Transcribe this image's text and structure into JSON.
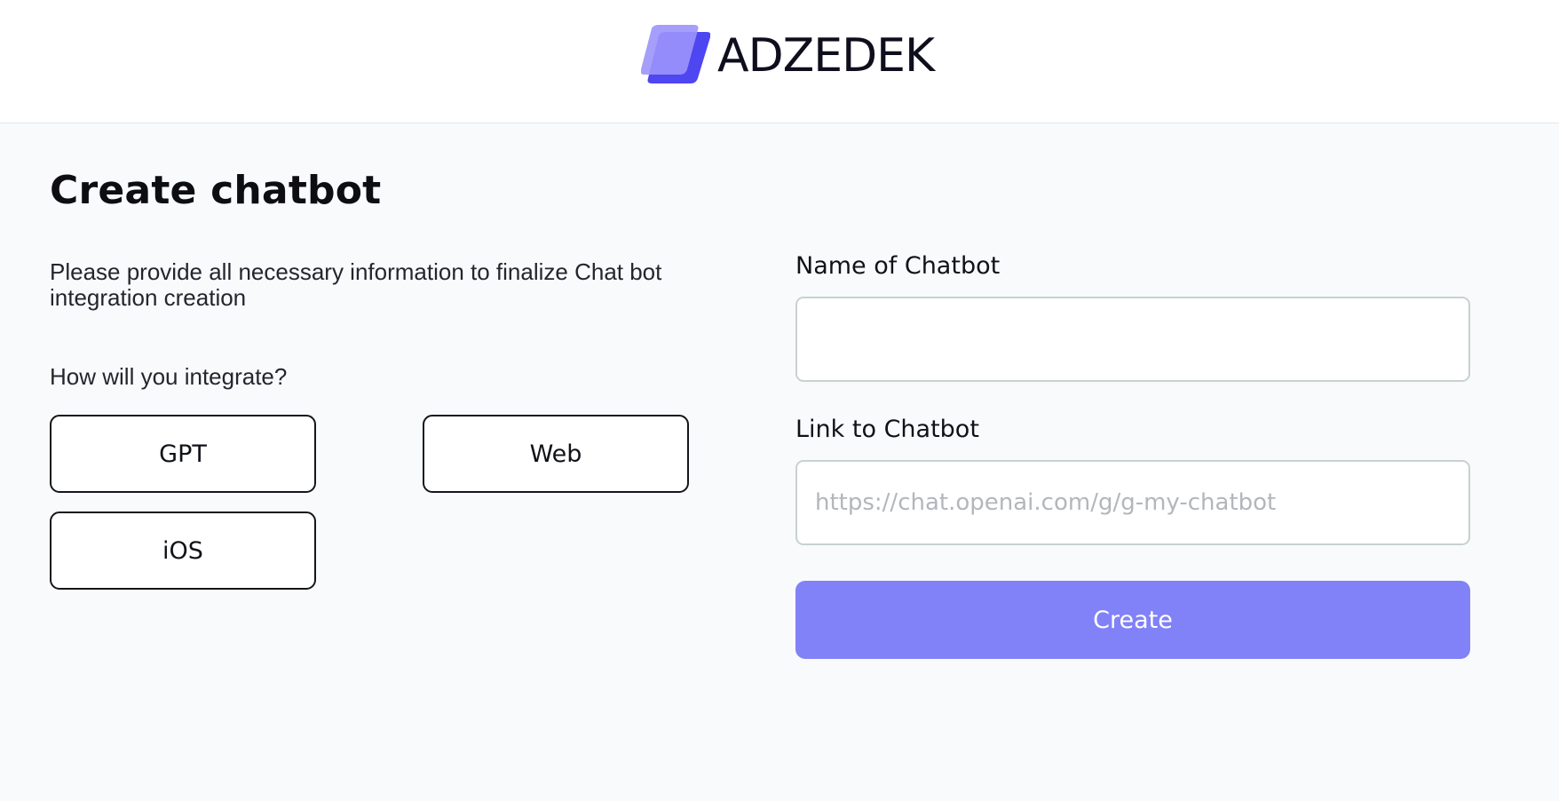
{
  "header": {
    "brand_name": "ADZEDEK",
    "logo_icon": "adzedek-logo-icon",
    "logo_colors": [
      "#8f86fb",
      "#4e46f0"
    ]
  },
  "form": {
    "title": "Create chatbot",
    "intro": "Please provide all necessary information to finalize Chat bot integration creation",
    "integration_question": "How will you integrate?",
    "integration_options": [
      "GPT",
      "Web",
      "iOS"
    ],
    "name_label": "Name of Chatbot",
    "name_value": "",
    "link_label": "Link to Chatbot",
    "link_placeholder": "https://chat.openai.com/g/g-my-chatbot",
    "link_value": "",
    "submit_label": "Create"
  },
  "colors": {
    "accent": "#8181f8",
    "page_background": "#f9fafc"
  }
}
